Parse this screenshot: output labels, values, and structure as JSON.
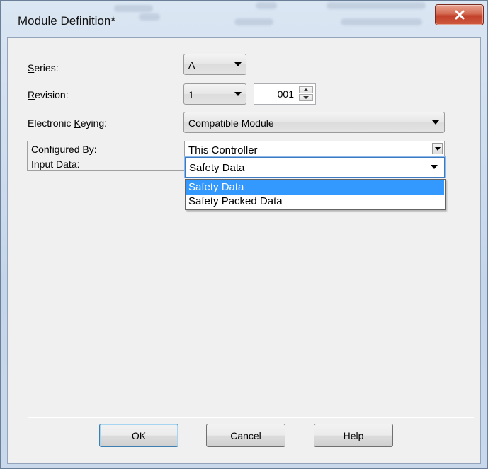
{
  "window": {
    "title": "Module Definition*"
  },
  "fields": {
    "series_label_accel": "S",
    "series_label_rest": "eries:",
    "series_value": "A",
    "revision_label_accel": "R",
    "revision_label_rest": "evision:",
    "revision_major": "1",
    "revision_minor": "001",
    "keying_label_pre": "Electronic ",
    "keying_label_accel": "K",
    "keying_label_rest": "eying:",
    "keying_value": "Compatible Module"
  },
  "property_grid": {
    "rows": [
      {
        "label": "Configured By:",
        "value": "This Controller"
      },
      {
        "label": "Input Data:",
        "value": "Safety Data"
      }
    ]
  },
  "dropdown": {
    "options": [
      "Safety Data",
      "Safety Packed Data"
    ],
    "selected_index": 0
  },
  "buttons": {
    "ok": "OK",
    "cancel": "Cancel",
    "help": "Help"
  },
  "colors": {
    "selection": "#3399ff",
    "close_button": "#c2402a"
  }
}
